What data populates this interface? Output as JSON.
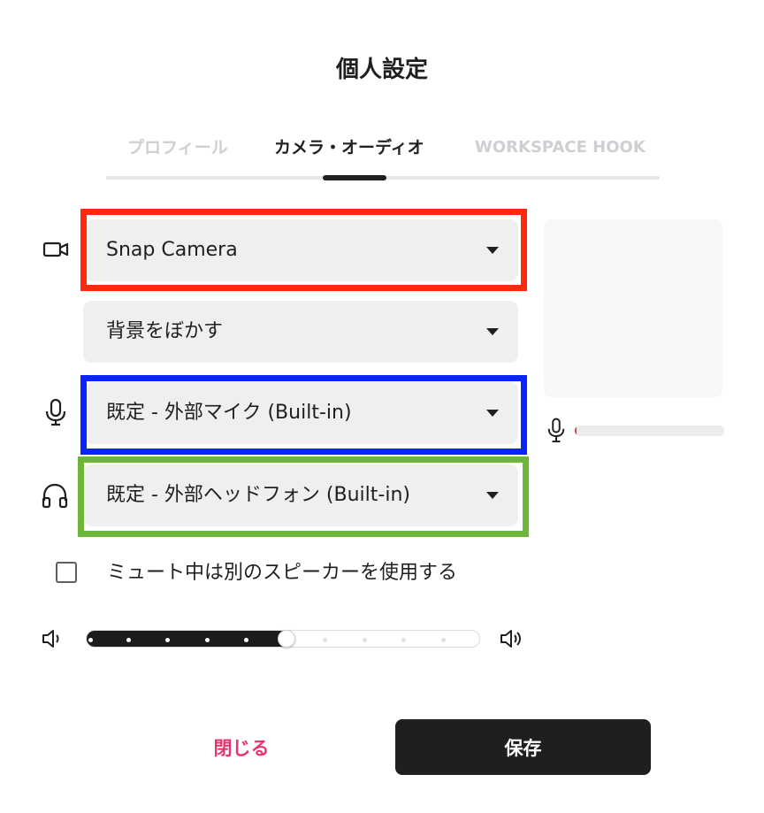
{
  "title": "個人設定",
  "tabs": [
    {
      "label": "プロフィール",
      "active": false
    },
    {
      "label": "カメラ・オーディオ",
      "active": true
    },
    {
      "label": "WORKSPACE HOOK",
      "active": false
    }
  ],
  "camera": {
    "value": "Snap Camera",
    "icon": "video-camera-icon"
  },
  "background": {
    "value": "背景をぼかす"
  },
  "microphone": {
    "value": "既定 - 外部マイク (Built-in)",
    "icon": "microphone-icon",
    "level": 0.01
  },
  "speaker": {
    "value": "既定 - 外部ヘッドフォン (Built-in)",
    "icon": "headphones-icon"
  },
  "mute_option": {
    "label": "ミュート中は別のスピーカーを使用する",
    "checked": false
  },
  "volume": {
    "value": 0.5,
    "steps": 10,
    "low_icon": "volume-low-icon",
    "high_icon": "volume-high-icon"
  },
  "buttons": {
    "close": "閉じる",
    "save": "保存"
  },
  "highlights": {
    "camera": "#ff2a0d",
    "microphone": "#0a24ff",
    "speaker": "#6cb63c"
  },
  "colors": {
    "accent": "#e8356d",
    "primary": "#1f1f1f",
    "level": "#e53a2e"
  }
}
